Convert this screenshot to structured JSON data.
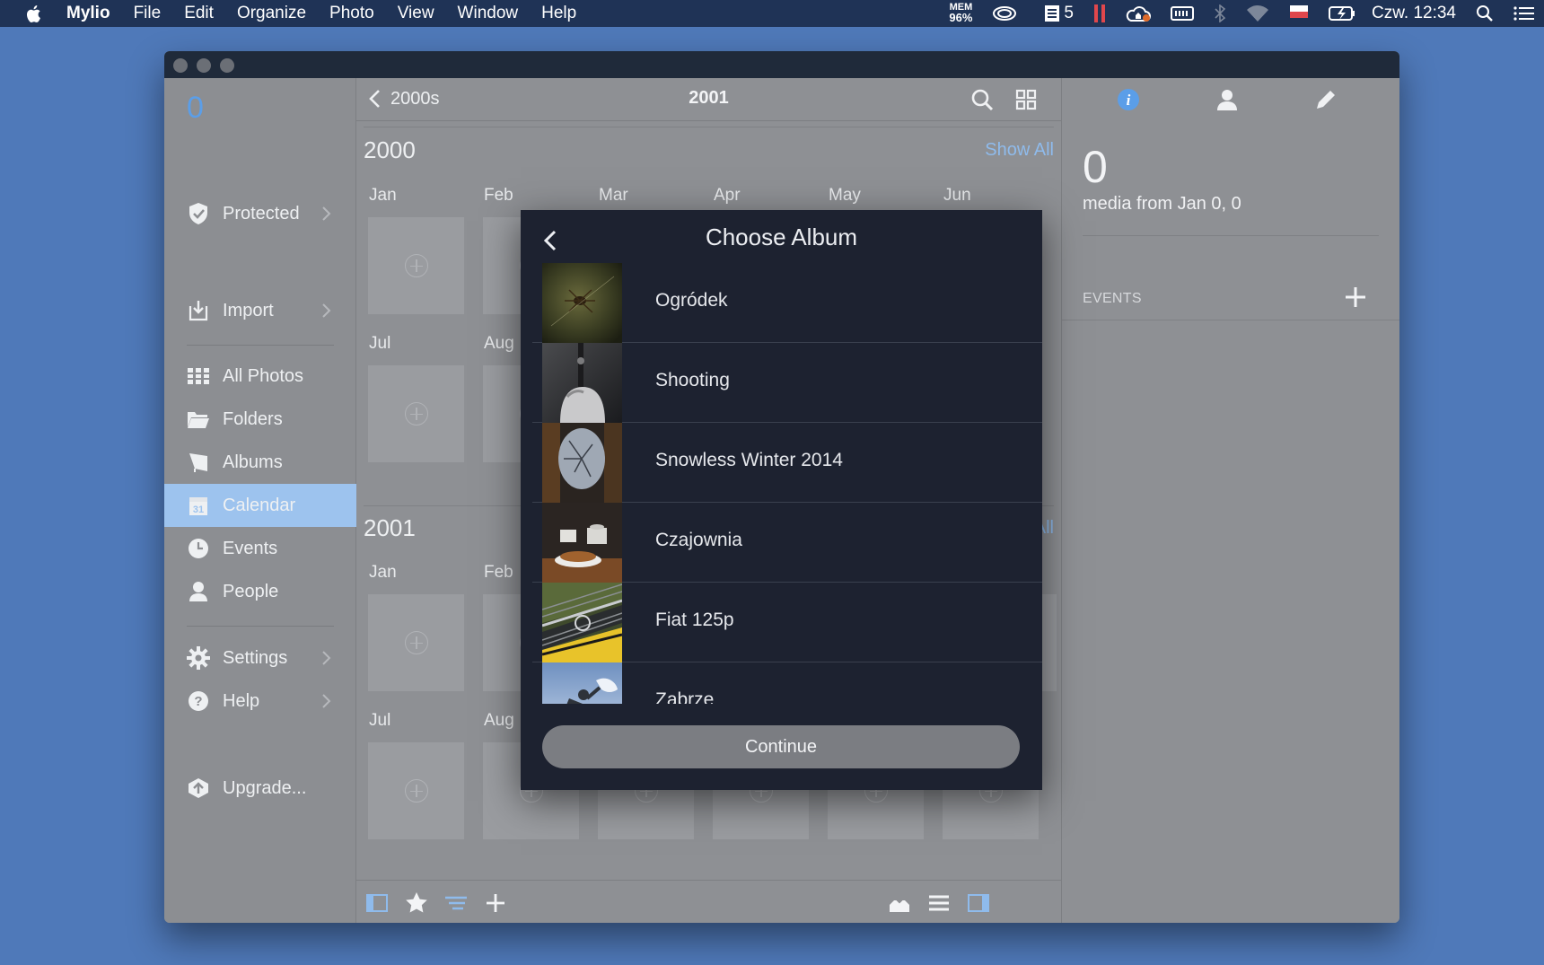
{
  "menubar": {
    "app_name": "Mylio",
    "menus": [
      "File",
      "Edit",
      "Organize",
      "Photo",
      "View",
      "Window",
      "Help"
    ],
    "mem_label": "MEM",
    "mem_value": "96%",
    "todo_count": "5",
    "clock": "Czw. 12:34"
  },
  "sidebar": {
    "count": "0",
    "items": [
      {
        "label": "Protected",
        "icon": "shield-check-icon"
      },
      {
        "label": "Import",
        "icon": "import-icon"
      },
      {
        "label": "All Photos",
        "icon": "grid-icon"
      },
      {
        "label": "Folders",
        "icon": "folder-icon"
      },
      {
        "label": "Albums",
        "icon": "album-icon"
      },
      {
        "label": "Calendar",
        "icon": "calendar-icon"
      },
      {
        "label": "Events",
        "icon": "clock-icon"
      },
      {
        "label": "People",
        "icon": "person-icon"
      },
      {
        "label": "Settings",
        "icon": "gear-icon"
      },
      {
        "label": "Help",
        "icon": "help-icon"
      },
      {
        "label": "Upgrade...",
        "icon": "upgrade-icon"
      }
    ],
    "active": "Calendar"
  },
  "main": {
    "back_label": "2000s",
    "title": "2001",
    "years": [
      {
        "label": "2000",
        "show_all": "Show All",
        "months_row1": [
          "Jan",
          "Feb",
          "Mar",
          "Apr",
          "May",
          "Jun"
        ],
        "months_row2": [
          "Jul",
          "Aug"
        ]
      },
      {
        "label": "2001",
        "show_all": "All",
        "months_row1": [
          "Jan",
          "Feb"
        ],
        "months_row2": [
          "Jul",
          "Aug"
        ]
      }
    ]
  },
  "right_panel": {
    "count": "0",
    "media_text": "media from Jan 0, 0",
    "events_label": "EVENTS"
  },
  "modal": {
    "title": "Choose Album",
    "albums": [
      {
        "name": "Ogródek"
      },
      {
        "name": "Shooting"
      },
      {
        "name": "Snowless Winter 2014"
      },
      {
        "name": "Czajownia"
      },
      {
        "name": "Fiat 125p"
      },
      {
        "name": "Zabrze"
      }
    ],
    "continue_label": "Continue"
  },
  "colors": {
    "desktop": "#4f79b9",
    "accent": "#5b9ee8",
    "sidebar_active": "#9dc3ee",
    "modal_bg": "#1d2230"
  }
}
